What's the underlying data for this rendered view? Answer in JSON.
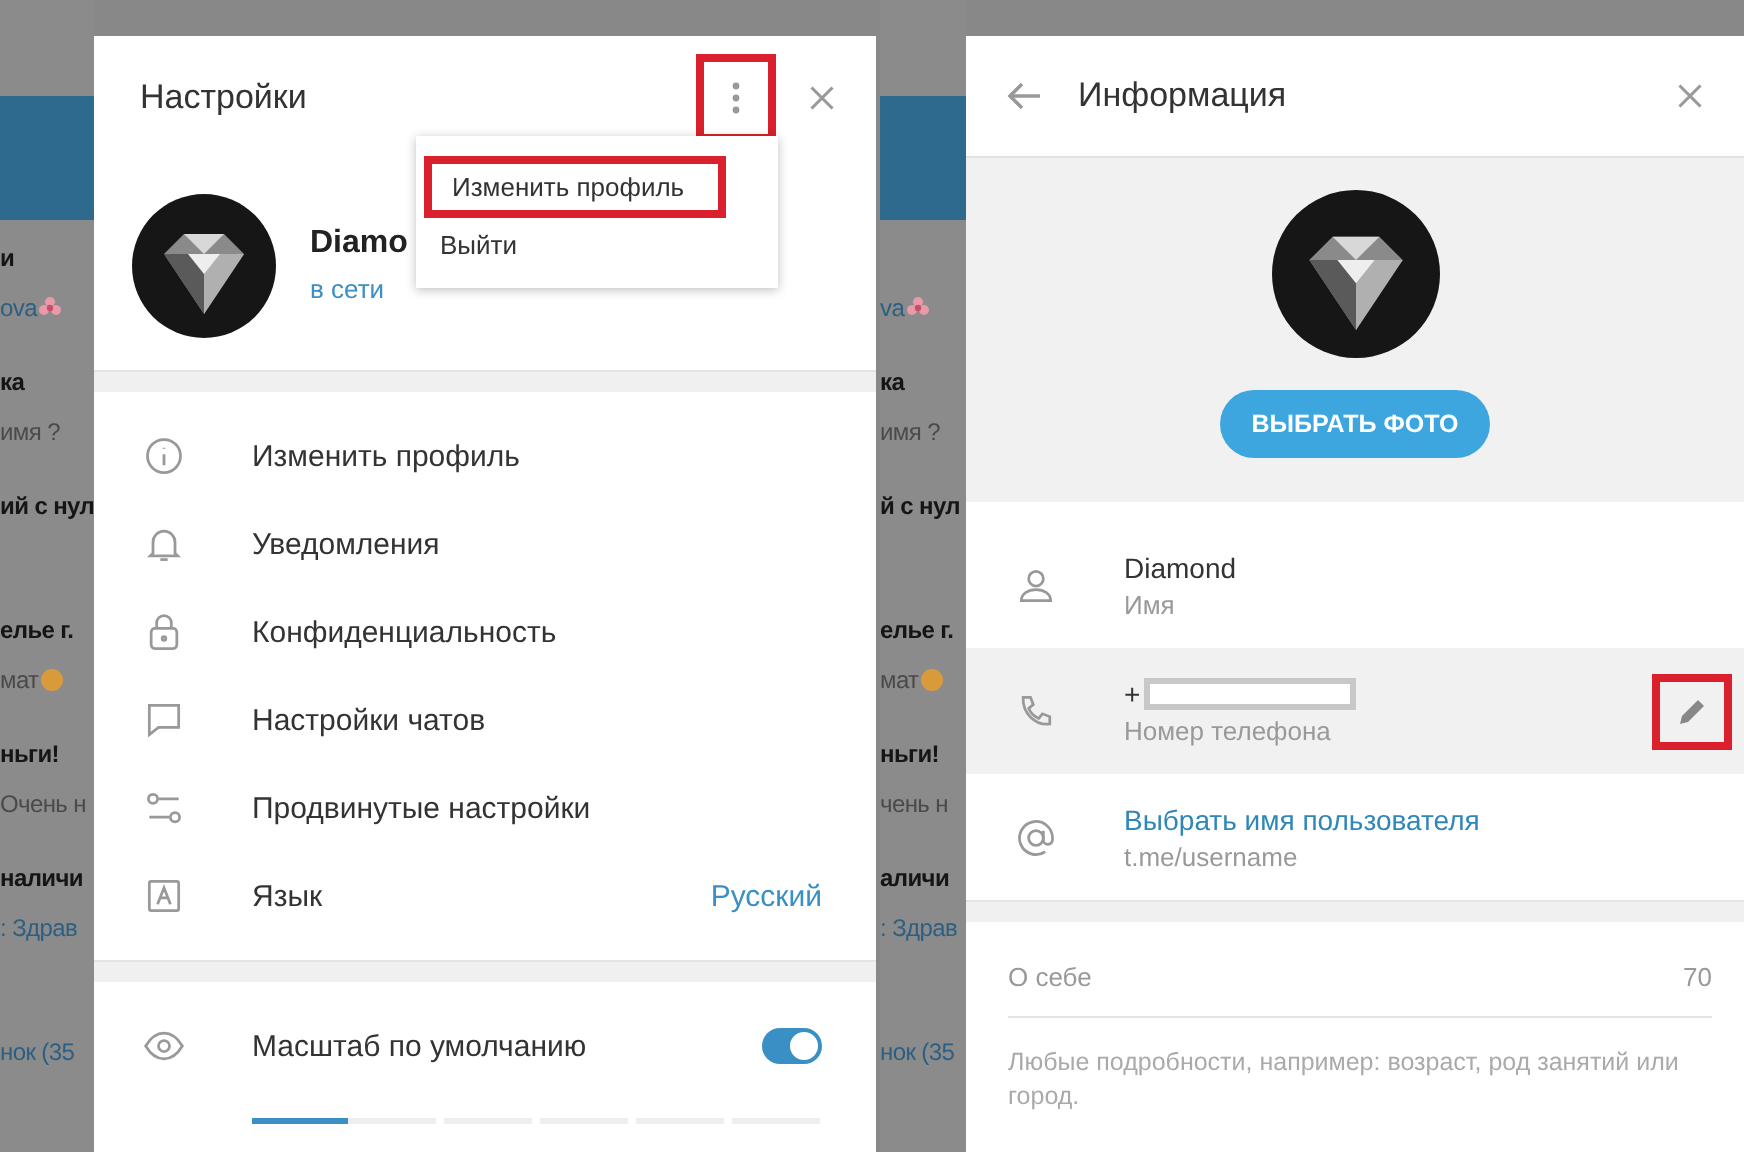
{
  "left_backdrop": {
    "chats": [
      {
        "title": "и",
        "preview": "ova",
        "accent": true,
        "kind": "flower"
      },
      {
        "title": "ка",
        "preview": "имя ?",
        "accent": false
      },
      {
        "title": "ий с нул"
      },
      {
        "title": "елье г.",
        "preview": "мат",
        "accent": false,
        "kind": "smile"
      },
      {
        "title": "ньги!",
        "preview": "Очень н",
        "accent": false
      },
      {
        "title": "наличи",
        "preview": ": Здрав",
        "accent": true
      },
      {
        "preview": "нок (35",
        "accent": true
      }
    ]
  },
  "settings": {
    "title": "Настройки",
    "more_button": {
      "highlighted": true
    },
    "menu": [
      {
        "label": "Изменить профиль",
        "highlighted": true
      },
      {
        "label": "Выйти",
        "highlighted": false
      }
    ],
    "profile": {
      "name": "Diamo",
      "status": "в сети"
    },
    "items": [
      {
        "label": "Изменить профиль"
      },
      {
        "label": "Уведомления"
      },
      {
        "label": "Конфиденциальность"
      },
      {
        "label": "Настройки чатов"
      },
      {
        "label": "Продвинутые настройки"
      },
      {
        "label": "Язык",
        "value": "Русский"
      }
    ],
    "scale": {
      "label": "Масштаб по умолчанию",
      "on": true,
      "level": 0.17
    }
  },
  "right_backdrop": {
    "chats": [
      {
        "preview": "va",
        "accent": true,
        "kind": "flower"
      },
      {
        "title": "ка",
        "preview": "имя ?",
        "accent": false
      },
      {
        "title": "й с нул"
      },
      {
        "title": "елье г.",
        "preview": "мат",
        "accent": false,
        "kind": "smile"
      },
      {
        "title": "ньги!",
        "preview": "чень н",
        "accent": false
      },
      {
        "title": "аличи",
        "preview": ": Здрав",
        "accent": true
      },
      {
        "preview": "нок (35",
        "accent": true
      }
    ]
  },
  "info": {
    "title": "Информация",
    "photo_button": "ВЫБРАТЬ ФОТО",
    "fields": [
      {
        "value": "Diamond",
        "caption": "Имя",
        "link": false,
        "hovered": false,
        "redacted": false
      },
      {
        "value": "+",
        "caption": "Номер телефона",
        "link": false,
        "hovered": true,
        "redacted": true,
        "edit": {
          "highlighted": true
        }
      },
      {
        "value": "Выбрать имя пользователя",
        "caption": "t.me/username",
        "link": true,
        "hovered": false,
        "redacted": false
      }
    ],
    "about": {
      "label": "О себе",
      "counter": "70",
      "hint": "Любые подробности, например: возраст, род занятий или город."
    }
  }
}
